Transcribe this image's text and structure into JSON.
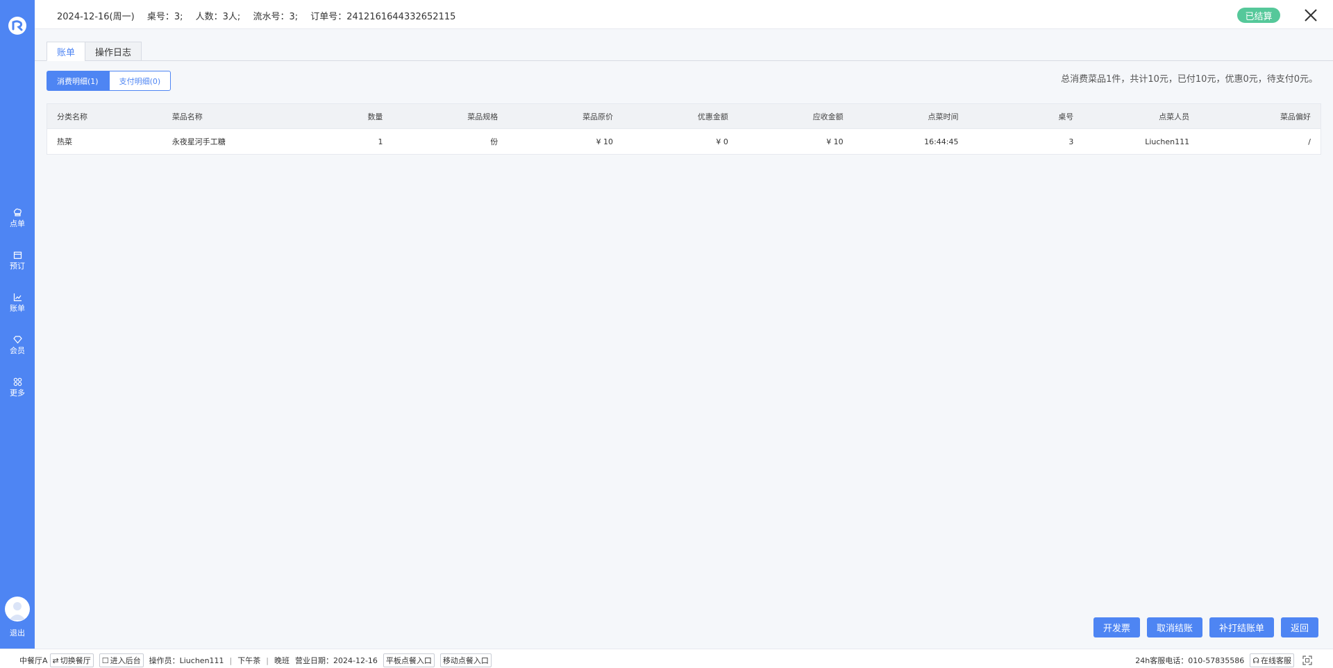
{
  "sidebar": {
    "items": [
      {
        "label": "点单",
        "icon": "chef-hat-icon"
      },
      {
        "label": "预订",
        "icon": "calendar-icon"
      },
      {
        "label": "账单",
        "icon": "chart-icon"
      },
      {
        "label": "会员",
        "icon": "diamond-icon"
      },
      {
        "label": "更多",
        "icon": "grid-icon"
      }
    ],
    "logout_label": "退出"
  },
  "topbar": {
    "date": "2024-12-16(周一)",
    "table_no": "桌号：3;",
    "guests": "人数：3人;",
    "serial": "流水号：3;",
    "order_no": "订单号：2412161644332652115",
    "status": "已结算"
  },
  "tabs": [
    {
      "label": "账单",
      "active": true
    },
    {
      "label": "操作日志",
      "active": false
    }
  ],
  "subtabs": [
    {
      "label": "消费明细(1)",
      "active": true
    },
    {
      "label": "支付明细(0)",
      "active": false
    }
  ],
  "summary": "总消费菜品1件，共计10元，已付10元，优惠0元，待支付0元。",
  "table": {
    "headers": [
      "分类名称",
      "菜品名称",
      "数量",
      "菜品规格",
      "菜品原价",
      "优惠金额",
      "应收金额",
      "点菜时间",
      "桌号",
      "点菜人员",
      "菜品偏好"
    ],
    "rows": [
      [
        "热菜",
        "永夜星河手工糖",
        "1",
        "份",
        "¥ 10",
        "¥ 0",
        "¥ 10",
        "16:44:45",
        "3",
        "Liuchen111",
        "/"
      ]
    ]
  },
  "actions": [
    "开发票",
    "取消结账",
    "补打结账单",
    "返回"
  ],
  "footer": {
    "hall": "中餐厅A",
    "switch_hall": "切换餐厅",
    "enter_backend": "进入后台",
    "operator": "操作员：Liuchen111",
    "shift_end": "下午茶",
    "shift": "晚班",
    "business_date": "营业日期：2024-12-16",
    "tablet_entry": "平板点餐入口",
    "mobile_entry": "移动点餐入口",
    "hotline": "24h客服电话：010-57835586",
    "online_service": "在线客服"
  },
  "colors": {
    "primary": "#4e85f3",
    "status_green": "#55c89a"
  }
}
